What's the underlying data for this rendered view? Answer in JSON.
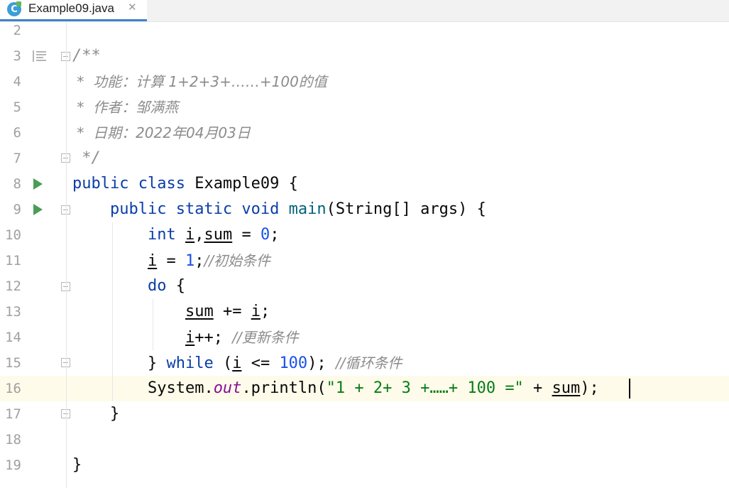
{
  "tab": {
    "label": "Example09.java",
    "icon_letter": "C",
    "close": "✕"
  },
  "lines": [
    {
      "n": "2"
    },
    {
      "n": "3",
      "c": "/**"
    },
    {
      "n": "4",
      "c": " *  功能：计算 1+2+3+……+100的值"
    },
    {
      "n": "5",
      "c": " *  作者：邹满燕"
    },
    {
      "n": "6",
      "c": " *  日期：2022年04月03日"
    },
    {
      "n": "7",
      "c": " */"
    },
    {
      "n": "8"
    },
    {
      "n": "9"
    },
    {
      "n": "10"
    },
    {
      "n": "11"
    },
    {
      "n": "12"
    },
    {
      "n": "13"
    },
    {
      "n": "14"
    },
    {
      "n": "15"
    },
    {
      "n": "16"
    },
    {
      "n": "17"
    },
    {
      "n": "18"
    },
    {
      "n": "19"
    }
  ],
  "code": {
    "l8_kw": "public class",
    "l8_rest": " Example09 {",
    "l9_kw": "public static void",
    "l9_mth": "main",
    "l9_rest": "(String[] args) {",
    "l10_kw": "int",
    "l10_i": "i",
    "l10_sum": "sum",
    "l10_eq": " = ",
    "l10_num": "0",
    "l11_i": "i",
    "l11_eq": " = ",
    "l11_num": "1",
    "l11_cmt": "//初始条件",
    "l12_kw": "do",
    "l12_rest": " {",
    "l13_sum": "sum",
    "l13_op": " += ",
    "l13_i": "i",
    "l14_i": "i",
    "l14_op": "++; ",
    "l14_cmt": "//更新条件",
    "l15_a": "} ",
    "l15_kw": "while",
    "l15_b": " (",
    "l15_i": "i",
    "l15_c": " <= ",
    "l15_num": "100",
    "l15_d": "); ",
    "l15_cmt": "//循环条件",
    "l16_a": "System.",
    "l16_fld": "out",
    "l16_b": ".println(",
    "l16_str": "\"1 + 2+ 3 +……+ 100 =\"",
    "l16_c": " + ",
    "l16_sum": "sum",
    "l16_d": ");",
    "l17": "}",
    "l19": "}"
  },
  "colors": {
    "keyword": "#0a3ea8",
    "number": "#1750eb",
    "string": "#067d17",
    "comment": "#8c8c8c",
    "field": "#871094",
    "current_line": "#fefbea"
  },
  "icons": {
    "run": "run-triangle-icon",
    "doc": "javadoc-icon",
    "fold": "fold-marker-icon"
  }
}
